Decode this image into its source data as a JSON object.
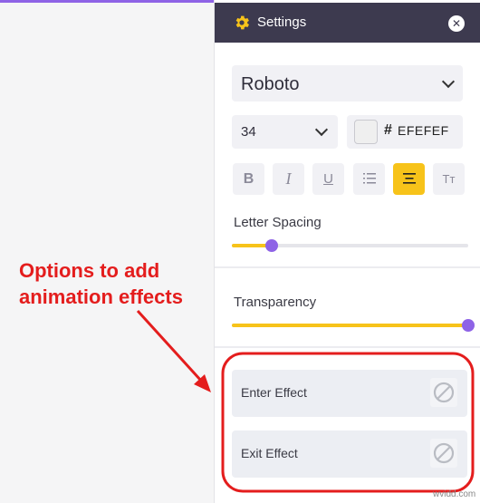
{
  "panel": {
    "title": "Settings",
    "close_icon": "close-icon",
    "font_family": "Roboto",
    "font_size": "34",
    "color_hash": "#",
    "color_hex": "EFEFEF",
    "color_value": "#efefef",
    "format_buttons": [
      {
        "name": "bold",
        "glyph": "B",
        "active": false
      },
      {
        "name": "italic",
        "glyph": "I",
        "active": false
      },
      {
        "name": "underline",
        "glyph": "U",
        "active": false
      },
      {
        "name": "list",
        "glyph": "list-icon",
        "active": false
      },
      {
        "name": "align-center",
        "glyph": "align-center-icon",
        "active": true
      },
      {
        "name": "text-transform",
        "glyph": "Tт",
        "active": false
      }
    ],
    "letter_spacing": {
      "label": "Letter Spacing",
      "value_fraction": 0.17
    },
    "transparency": {
      "label": "Transparency",
      "value_fraction": 1.0
    },
    "effects": [
      {
        "label": "Enter Effect",
        "icon": "none-icon"
      },
      {
        "label": "Exit Effect",
        "icon": "none-icon"
      }
    ]
  },
  "annotation": {
    "line1": "Options to add",
    "line2": "animation effects",
    "color": "#e41d1d"
  },
  "colors": {
    "accent": "#f7c31a",
    "slider_thumb": "#8e63e6",
    "header_bg": "#3d3a4f"
  },
  "watermark": "wvidd.com"
}
